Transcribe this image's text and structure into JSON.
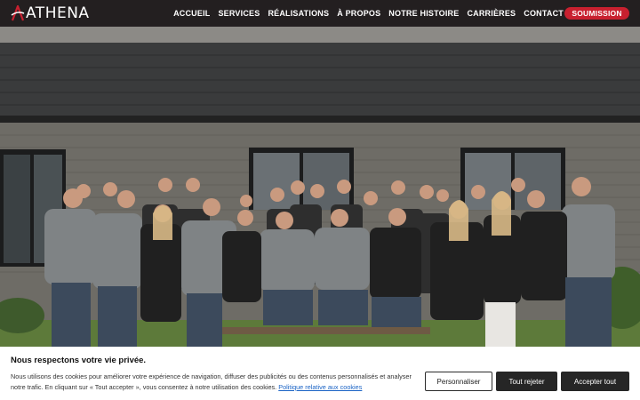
{
  "brand": {
    "name": "ATHENA"
  },
  "nav": {
    "items": [
      "ACCUEIL",
      "SERVICES",
      "RÉALISATIONS",
      "À PROPOS",
      "NOTRE HISTOIRE",
      "CARRIÈRES",
      "CONTACT"
    ],
    "cta_label": "SOUMISSION"
  },
  "colors": {
    "accent": "#c8202f",
    "header_bg": "#231f20",
    "link": "#1a63c5"
  },
  "cookie": {
    "title": "Nous respectons votre vie privée.",
    "text": "Nous utilisons des cookies pour améliorer votre expérience de navigation, diffuser des publicités ou des contenus personnalisés et analyser notre trafic. En cliquant sur « Tout accepter », vous consentez à notre utilisation des cookies.",
    "policy_link": "Politique relative aux cookies",
    "customize_label": "Personnaliser",
    "reject_label": "Tout rejeter",
    "accept_label": "Accepter tout"
  }
}
